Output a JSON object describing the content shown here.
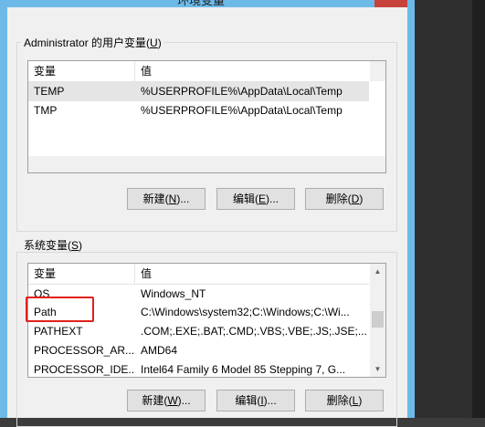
{
  "window": {
    "title": "环境变量"
  },
  "user_vars": {
    "group_label": "Administrator 的用户变量(",
    "group_accel": "U",
    "group_label_end": ")",
    "headers": {
      "name": "变量",
      "value": "值"
    },
    "rows": [
      {
        "name": "TEMP",
        "value": "%USERPROFILE%\\AppData\\Local\\Temp"
      },
      {
        "name": "TMP",
        "value": "%USERPROFILE%\\AppData\\Local\\Temp"
      }
    ],
    "buttons": {
      "new": {
        "label": "新建(",
        "accel": "N",
        "end": ")..."
      },
      "edit": {
        "label": "编辑(",
        "accel": "E",
        "end": ")..."
      },
      "delete": {
        "label": "删除(",
        "accel": "D",
        "end": ")"
      }
    }
  },
  "system_vars": {
    "group_label": "系统变量(",
    "group_accel": "S",
    "group_label_end": ")",
    "headers": {
      "name": "变量",
      "value": "值"
    },
    "rows": [
      {
        "name": "OS",
        "value": "Windows_NT"
      },
      {
        "name": "Path",
        "value": "C:\\Windows\\system32;C:\\Windows;C:\\Wi..."
      },
      {
        "name": "PATHEXT",
        "value": ".COM;.EXE;.BAT;.CMD;.VBS;.VBE;.JS;.JSE;..."
      },
      {
        "name": "PROCESSOR_AR...",
        "value": "AMD64"
      },
      {
        "name": "PROCESSOR_IDE...",
        "value": "Intel64 Family 6 Model 85 Stepping 7, G..."
      }
    ],
    "buttons": {
      "new": {
        "label": "新建(",
        "accel": "W",
        "end": ")..."
      },
      "edit": {
        "label": "编辑(",
        "accel": "I",
        "end": ")..."
      },
      "delete": {
        "label": "删除(",
        "accel": "L",
        "end": ")"
      }
    }
  },
  "colors": {
    "frame": "#6dbae8",
    "highlight": "#e0201b",
    "close_button": "#c7423a"
  },
  "icons": [
    "scroll-up-arrow-icon",
    "scroll-down-arrow-icon",
    "scroll-right-arrow-icon"
  ]
}
